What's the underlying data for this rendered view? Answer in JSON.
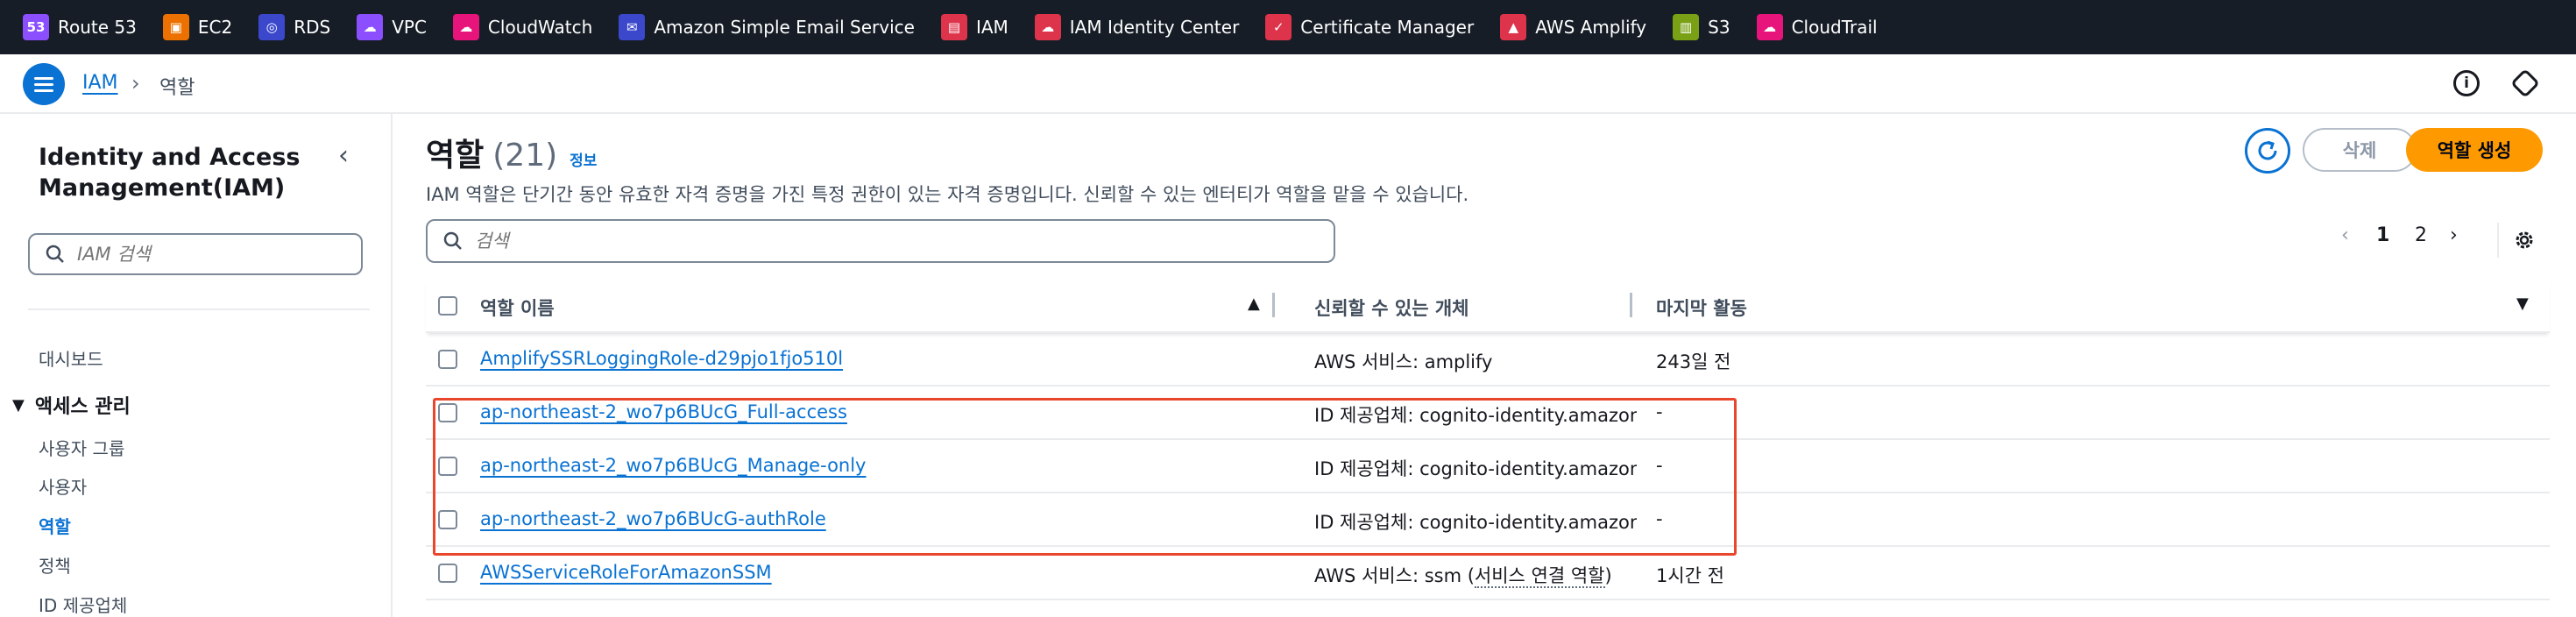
{
  "service_bar": [
    {
      "label": "Route 53",
      "icon": "route53-icon",
      "color": "#8c4fff",
      "glyph": "53"
    },
    {
      "label": "EC2",
      "icon": "ec2-icon",
      "color": "#ed7100",
      "glyph": "▣"
    },
    {
      "label": "RDS",
      "icon": "rds-icon",
      "color": "#3b48cc",
      "glyph": "◎"
    },
    {
      "label": "VPC",
      "icon": "vpc-icon",
      "color": "#8c4fff",
      "glyph": "☁"
    },
    {
      "label": "CloudWatch",
      "icon": "cloudwatch-icon",
      "color": "#e7157b",
      "glyph": "☁"
    },
    {
      "label": "Amazon Simple Email Service",
      "icon": "ses-icon",
      "color": "#3b48cc",
      "glyph": "✉"
    },
    {
      "label": "IAM",
      "icon": "iam-icon",
      "color": "#dd344c",
      "glyph": "▤"
    },
    {
      "label": "IAM Identity Center",
      "icon": "iam-identity-center-icon",
      "color": "#dd344c",
      "glyph": "☁"
    },
    {
      "label": "Certificate Manager",
      "icon": "certificate-manager-icon",
      "color": "#dd344c",
      "glyph": "✓"
    },
    {
      "label": "AWS Amplify",
      "icon": "amplify-icon",
      "color": "#dd344c",
      "glyph": "▲"
    },
    {
      "label": "S3",
      "icon": "s3-icon",
      "color": "#7aa116",
      "glyph": "▥"
    },
    {
      "label": "CloudTrail",
      "icon": "cloudtrail-icon",
      "color": "#e7157b",
      "glyph": "☁"
    }
  ],
  "breadcrumb": {
    "root": "IAM",
    "current": "역할"
  },
  "sidenav": {
    "title": "Identity and Access Management(IAM)",
    "search_placeholder": "IAM 검색",
    "dashboard": "대시보드",
    "section": "액세스 관리",
    "items": [
      "사용자 그룹",
      "사용자",
      "역할",
      "정책",
      "ID 제공업체"
    ],
    "active_item": "역할"
  },
  "page": {
    "title": "역할",
    "count": "(21)",
    "info": "정보",
    "description": "IAM 역할은 단기간 동안 유효한 자격 증명을 가진 특정 권한이 있는 자격 증명입니다. 신뢰할 수 있는 엔터티가 역할을 맡을 수 있습니다.",
    "search_placeholder": "검색",
    "delete_label": "삭제",
    "create_label": "역할 생성",
    "pagination": {
      "pages": [
        "1",
        "2"
      ],
      "current": "1"
    }
  },
  "table": {
    "headers": {
      "role_name": "역할 이름",
      "trusted_entity": "신뢰할 수 있는 개체",
      "last_activity": "마지막 활동"
    },
    "rows": [
      {
        "role_name": "AmplifySSRLoggingRole-d29pjo1fjo510l",
        "trusted_entity": "AWS 서비스: amplify",
        "trusted_suffix": "",
        "last_activity": "243일 전"
      },
      {
        "role_name": "ap-northeast-2_wo7p6BUcG_Full-access",
        "trusted_entity": "ID 제공업체: cognito-identity.amazonaws.com",
        "trusted_suffix": "",
        "last_activity": "-"
      },
      {
        "role_name": "ap-northeast-2_wo7p6BUcG_Manage-only",
        "trusted_entity": "ID 제공업체: cognito-identity.amazonaws.com",
        "trusted_suffix": "",
        "last_activity": "-"
      },
      {
        "role_name": "ap-northeast-2_wo7p6BUcG-authRole",
        "trusted_entity": "ID 제공업체: cognito-identity.amazonaws.com",
        "trusted_suffix": "",
        "last_activity": "-"
      },
      {
        "role_name": "AWSServiceRoleForAmazonSSM",
        "trusted_entity": "AWS 서비스: ssm (",
        "trusted_suffix": "서비스 연결 역할",
        "last_activity": "1시간 전"
      }
    ]
  },
  "highlight_color": "#e8472e",
  "accent_color": "#0972d3",
  "primary_button_color": "#ff9900"
}
